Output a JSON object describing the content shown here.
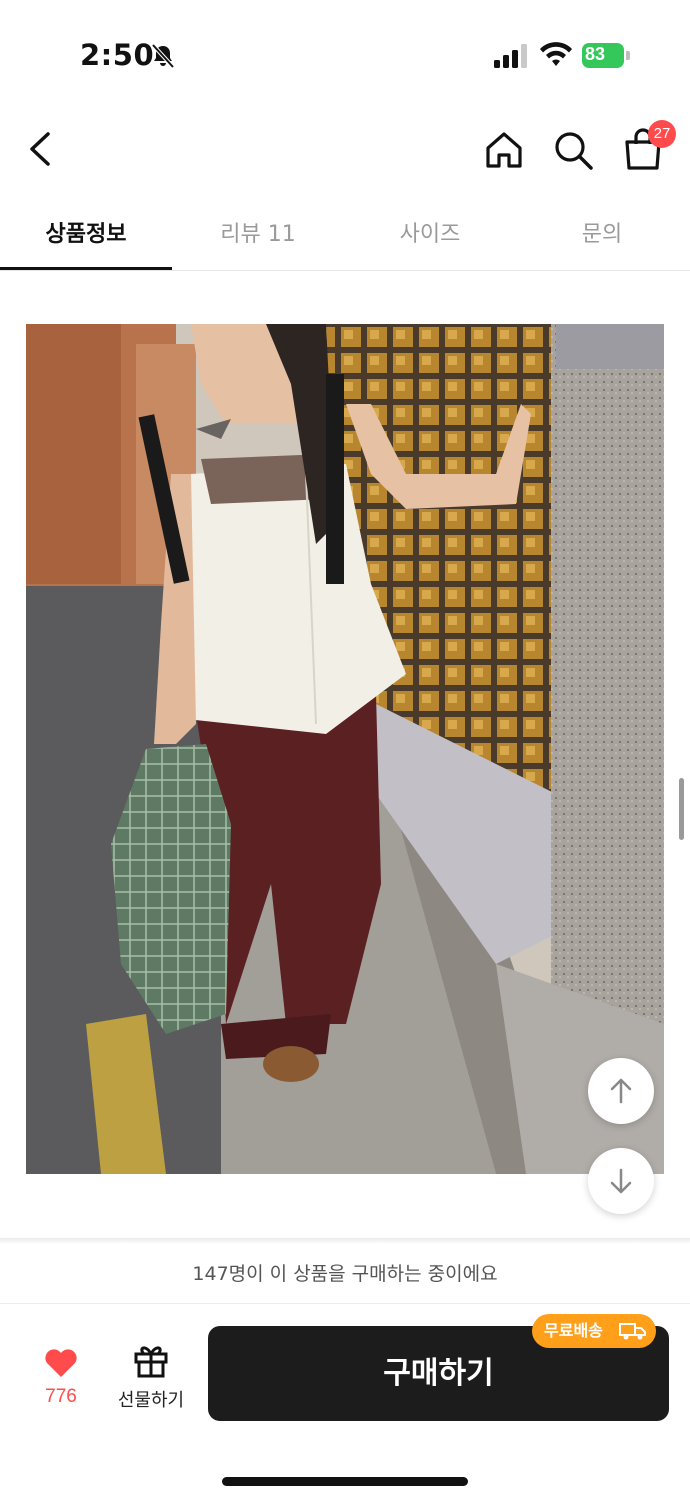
{
  "status_bar": {
    "time": "2:50",
    "battery": "83"
  },
  "nav": {
    "back_icon": "chevron-left-icon",
    "home_icon": "home-icon",
    "search_icon": "search-icon",
    "cart_icon": "shopping-bag-icon",
    "cart_badge": "27"
  },
  "tabs": [
    {
      "label": "상품정보",
      "active": true
    },
    {
      "label": "리뷰 11",
      "active": false
    },
    {
      "label": "사이즈",
      "active": false
    },
    {
      "label": "문의",
      "active": false
    }
  ],
  "product_image": {
    "subject": "model wearing white sleeveless peplum top and burgundy wide pants beside glass-block wall"
  },
  "floating": {
    "up_icon": "arrow-up-icon",
    "down_icon": "arrow-down-icon"
  },
  "buyers_banner": "147명이 이 상품을 구매하는 중이에요",
  "bottom_bar": {
    "like_count": "776",
    "gift_label": "선물하기",
    "buy_label": "구매하기",
    "free_shipping": "무료배송"
  },
  "colors": {
    "accent_red": "#ff4b4b",
    "battery_green": "#34c759",
    "buy_button": "#1c1c1c",
    "free_shipping_orange": "#ff9f1a"
  }
}
